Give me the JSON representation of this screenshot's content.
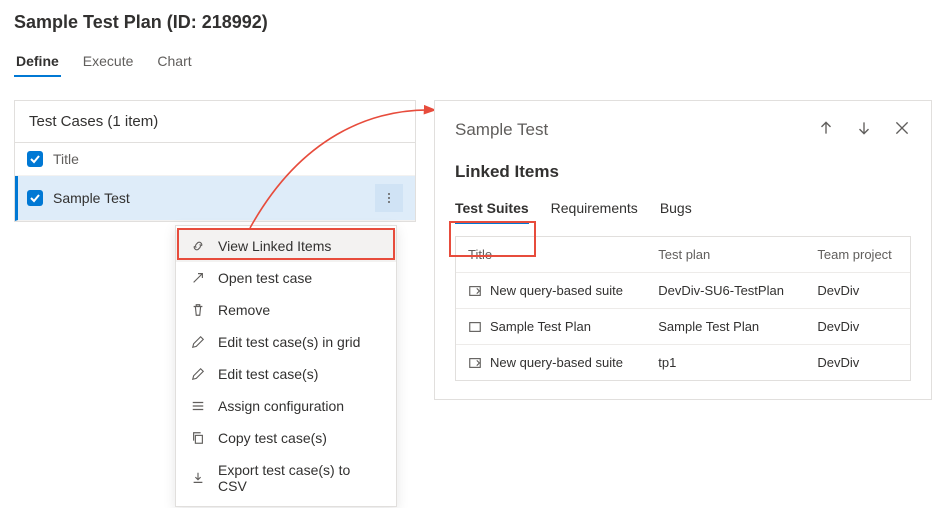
{
  "header": {
    "title": "Sample Test Plan (ID: 218992)"
  },
  "mainTabs": [
    {
      "label": "Define",
      "active": true
    },
    {
      "label": "Execute",
      "active": false
    },
    {
      "label": "Chart",
      "active": false
    }
  ],
  "testCases": {
    "heading": "Test Cases (1 item)",
    "columnLabel": "Title",
    "rows": [
      {
        "title": "Sample Test",
        "selected": true
      }
    ]
  },
  "contextMenu": [
    {
      "icon": "link-icon",
      "label": "View Linked Items",
      "highlighted": true
    },
    {
      "icon": "open-icon",
      "label": "Open test case"
    },
    {
      "icon": "trash-icon",
      "label": "Remove"
    },
    {
      "icon": "pencil-icon",
      "label": "Edit test case(s) in grid"
    },
    {
      "icon": "pencil-icon",
      "label": "Edit test case(s)"
    },
    {
      "icon": "config-icon",
      "label": "Assign configuration"
    },
    {
      "icon": "copy-icon",
      "label": "Copy test case(s)"
    },
    {
      "icon": "download-icon",
      "label": "Export test case(s) to CSV"
    }
  ],
  "linkedPanel": {
    "title": "Sample Test",
    "subtitle": "Linked Items",
    "tabs": [
      {
        "label": "Test Suites",
        "active": true
      },
      {
        "label": "Requirements",
        "active": false
      },
      {
        "label": "Bugs",
        "active": false
      }
    ],
    "columns": {
      "c1": "Title",
      "c2": "Test plan",
      "c3": "Team project"
    },
    "rows": [
      {
        "icon": "query-suite",
        "title": "New query-based suite",
        "plan": "DevDiv-SU6-TestPlan",
        "project": "DevDiv"
      },
      {
        "icon": "static-suite",
        "title": "Sample Test Plan",
        "plan": "Sample Test Plan",
        "project": "DevDiv"
      },
      {
        "icon": "query-suite",
        "title": "New query-based suite",
        "plan": "tp1",
        "project": "DevDiv"
      }
    ]
  }
}
